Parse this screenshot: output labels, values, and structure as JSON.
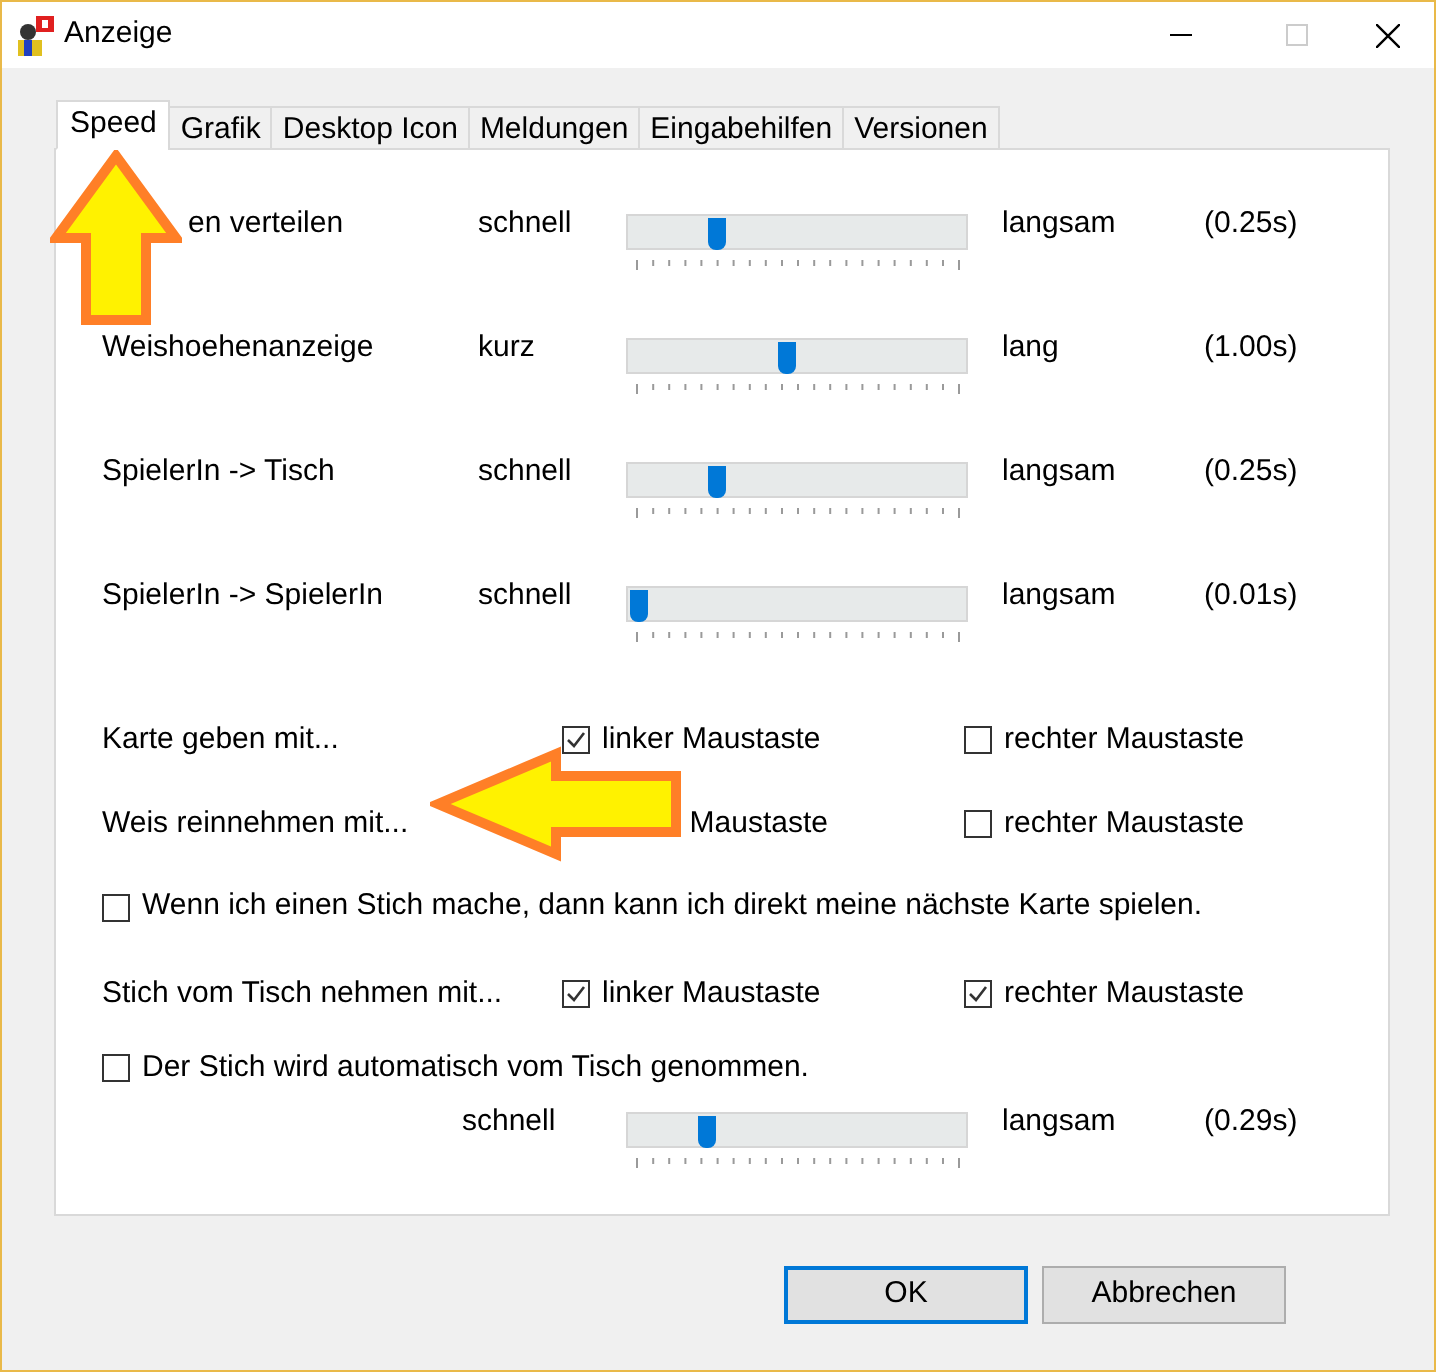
{
  "window": {
    "title": "Anzeige"
  },
  "tabs": [
    {
      "label": "Speed",
      "selected": true
    },
    {
      "label": "Grafik",
      "selected": false
    },
    {
      "label": "Desktop Icon",
      "selected": false
    },
    {
      "label": "Meldungen",
      "selected": false
    },
    {
      "label": "Eingabehilfen",
      "selected": false
    },
    {
      "label": "Versionen",
      "selected": false
    }
  ],
  "rows": [
    {
      "kind": "slider",
      "label": "en verteilen",
      "cut_left": true,
      "min_label": "schnell",
      "max_label": "langsam",
      "level": 0.25,
      "reading": "(0.25s)"
    },
    {
      "kind": "slider",
      "label": "Weishoehenanzeige",
      "min_label": "kurz",
      "max_label": "lang",
      "level": 0.47,
      "reading": "(1.00s)"
    },
    {
      "kind": "slider",
      "label": "SpielerIn -> Tisch",
      "min_label": "schnell",
      "max_label": "langsam",
      "level": 0.25,
      "reading": "(0.25s)"
    },
    {
      "kind": "slider",
      "label": "SpielerIn -> SpielerIn",
      "min_label": "schnell",
      "max_label": "langsam",
      "level": 0.01,
      "reading": "(0.01s)"
    },
    {
      "kind": "mouse",
      "label": "Karte geben mit...",
      "options": [
        {
          "label": "linker Maustaste",
          "checked": true
        },
        {
          "label": "rechter Maustaste",
          "checked": false
        }
      ]
    },
    {
      "kind": "mouse",
      "label": "Weis reinnehmen mit...",
      "options": [
        {
          "label": "Maustaste",
          "box_hidden": true
        },
        {
          "label": "rechter Maustaste",
          "checked": false
        }
      ]
    },
    {
      "kind": "check",
      "label": "Wenn ich einen Stich mache, dann kann ich direkt meine nächste Karte spielen.",
      "checked": false
    },
    {
      "kind": "mouse",
      "label": "Stich vom Tisch nehmen mit...",
      "options": [
        {
          "label": "linker Maustaste",
          "checked": true
        },
        {
          "label": "rechter Maustaste",
          "checked": true
        }
      ]
    },
    {
      "kind": "check",
      "label": "Der Stich wird automatisch vom Tisch genommen.",
      "checked": false
    },
    {
      "kind": "slider",
      "min_label": "schnell",
      "max_label": "langsam",
      "level": 0.22,
      "reading": "(0.29s)"
    }
  ],
  "buttons": [
    {
      "label": "OK",
      "default": true
    },
    {
      "label": "Abbrechen",
      "default": false
    }
  ]
}
